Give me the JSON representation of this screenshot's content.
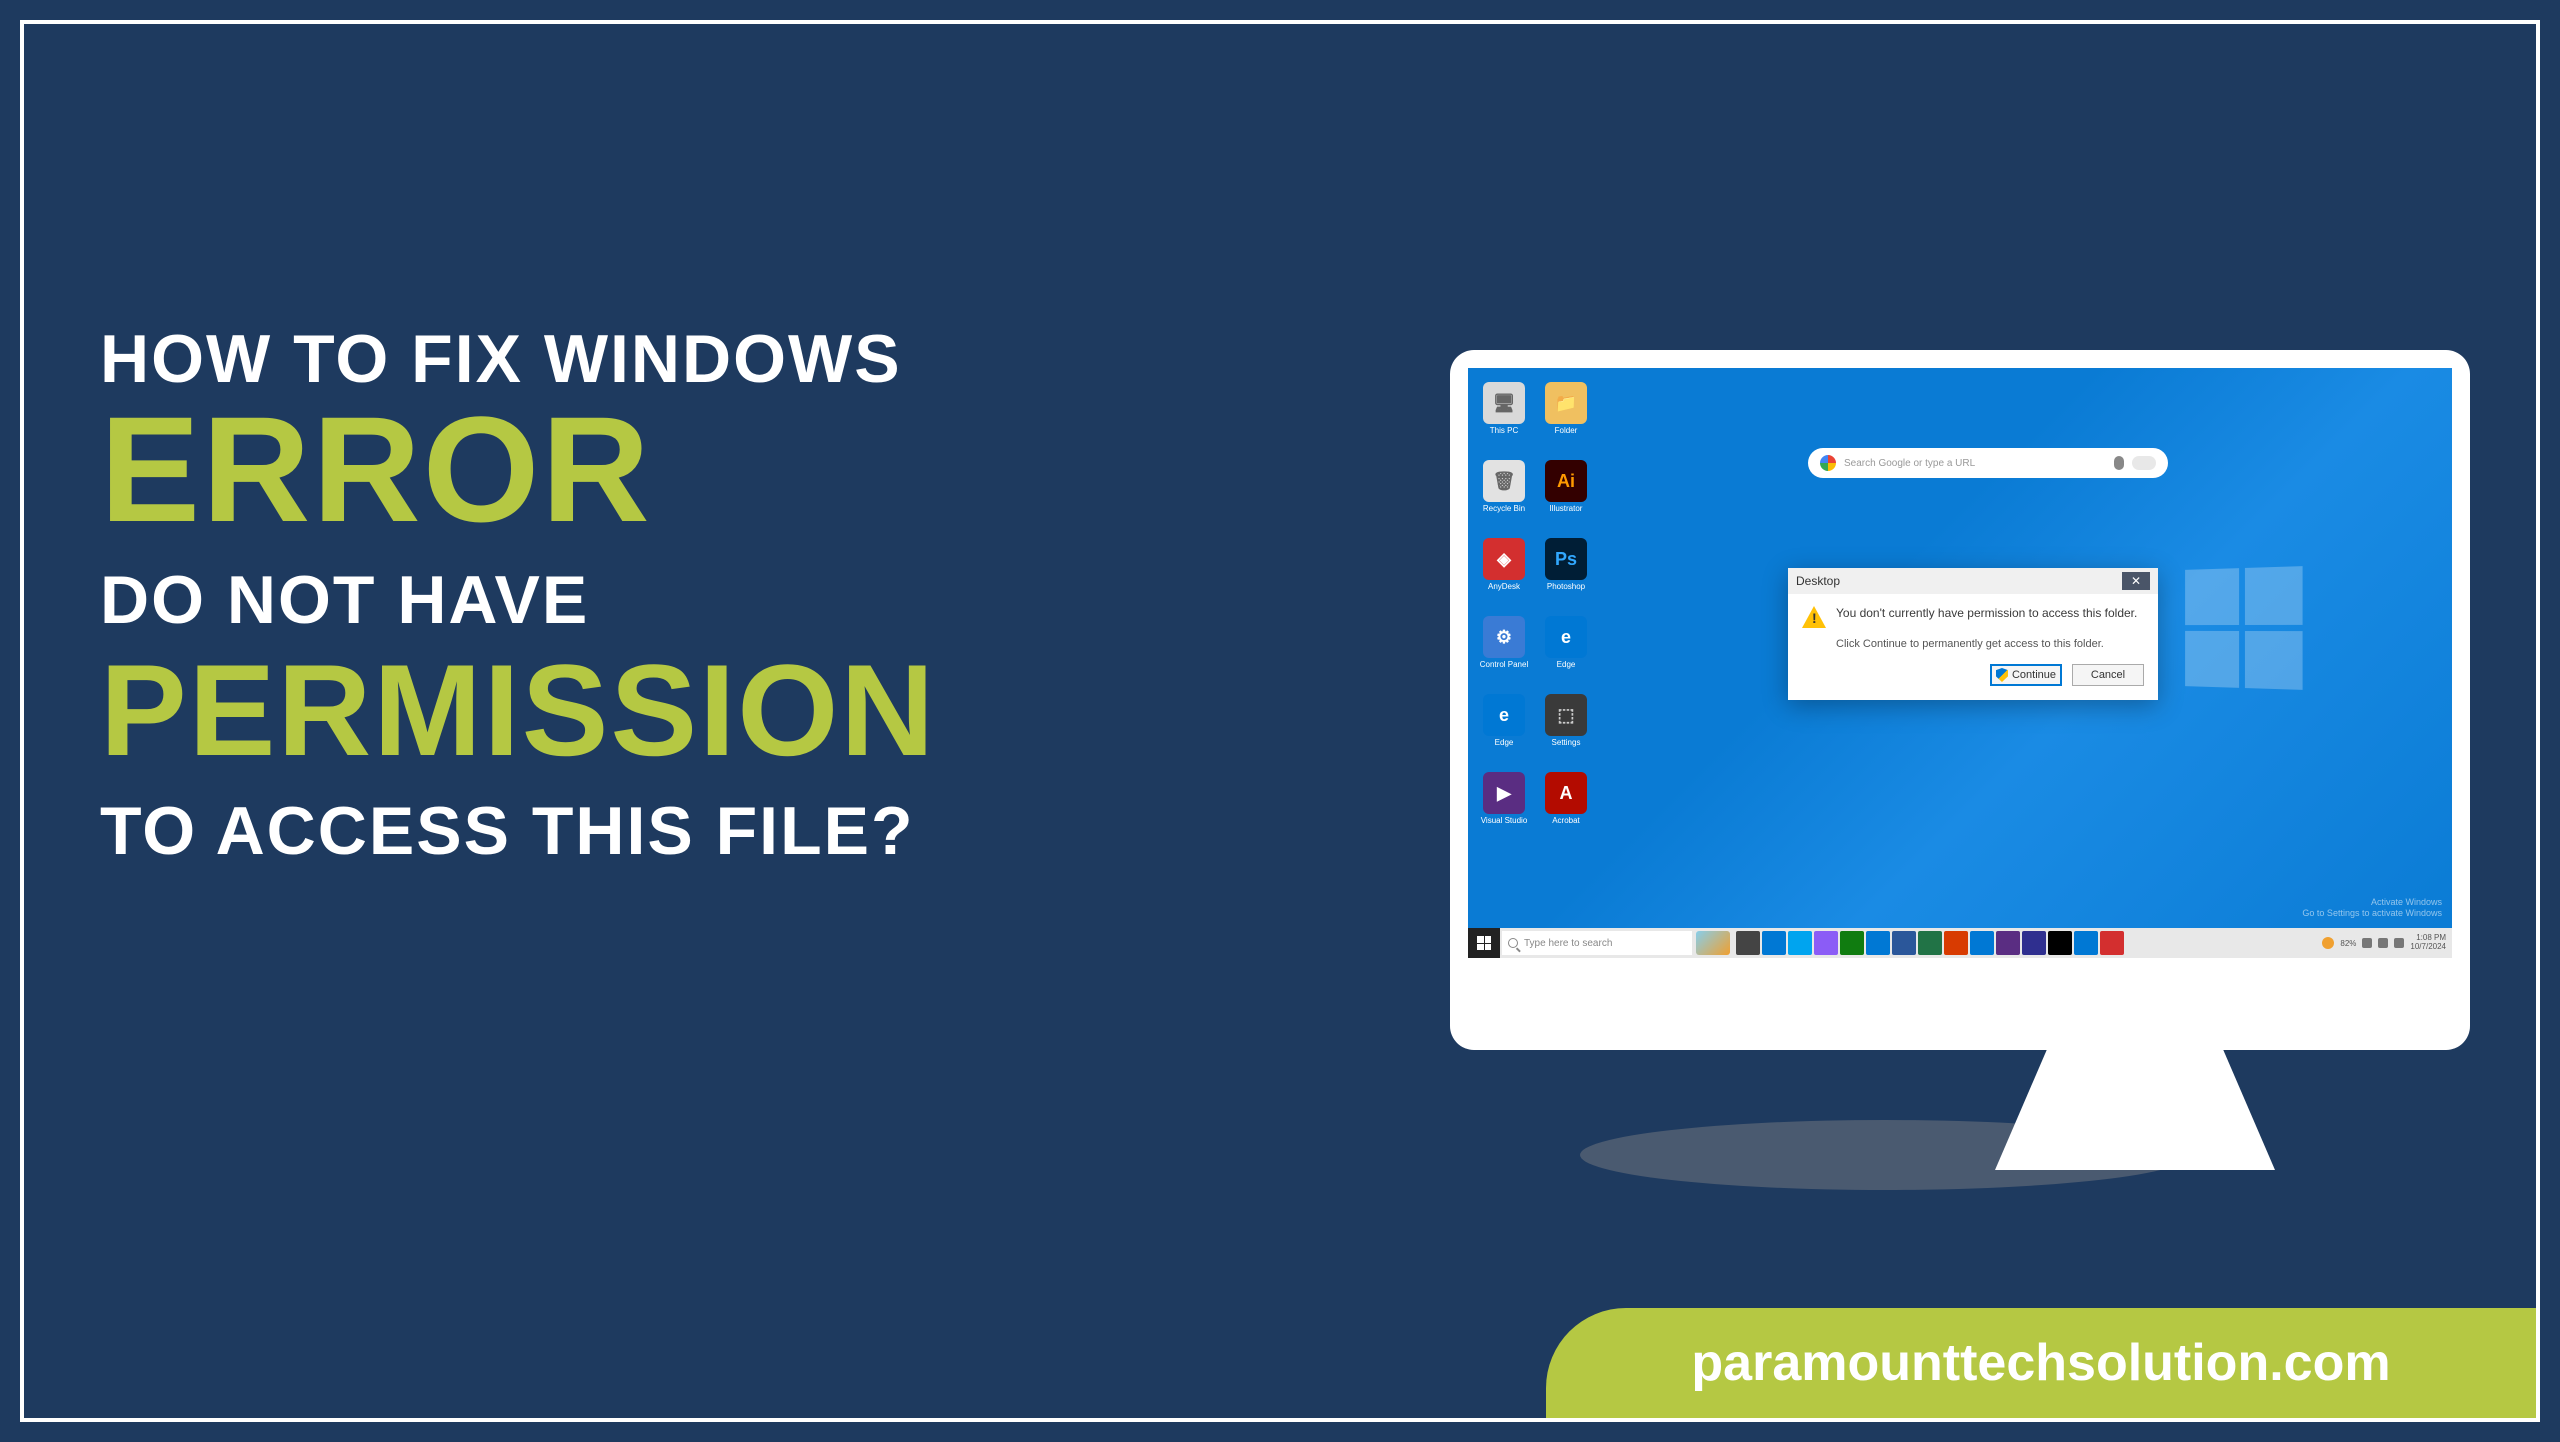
{
  "heading": {
    "line1": "HOW TO FIX WINDOWS",
    "line2": "ERROR",
    "line3": "DO NOT HAVE",
    "line4": "PERMISSION",
    "line5": "TO ACCESS THIS FILE?"
  },
  "brand": "paramounttechsolution.com",
  "screen": {
    "search_placeholder": "Search Google or type a URL",
    "dialog": {
      "title": "Desktop",
      "close": "✕",
      "message": "You don't currently have permission to access this folder.",
      "sub": "Click Continue to permanently get access to this folder.",
      "continue": "Continue",
      "cancel": "Cancel"
    },
    "watermark": {
      "l1": "Activate Windows",
      "l2": "Go to Settings to activate Windows"
    },
    "taskbar": {
      "search": "Type here to search",
      "battery": "82%",
      "time": "1:08 PM",
      "date": "10/7/2024"
    },
    "icons": {
      "col1": [
        {
          "bg": "#d9d9d9",
          "fg": "#666",
          "lbl": "This PC",
          "txt": "🖥"
        },
        {
          "bg": "#e2e2e2",
          "fg": "#666",
          "lbl": "Recycle Bin",
          "txt": "🗑"
        },
        {
          "bg": "#d32f2f",
          "fg": "#fff",
          "lbl": "AnyDesk",
          "txt": "◈"
        },
        {
          "bg": "#3a7bd5",
          "fg": "#fff",
          "lbl": "Control Panel",
          "txt": "⚙"
        },
        {
          "bg": "#0078d4",
          "fg": "#fff",
          "lbl": "Edge",
          "txt": "e"
        },
        {
          "bg": "#5a2d82",
          "fg": "#fff",
          "lbl": "Visual Studio",
          "txt": "▶"
        }
      ],
      "col2": [
        {
          "bg": "#f0c060",
          "fg": "#885",
          "lbl": "Folder",
          "txt": "📁"
        },
        {
          "bg": "#330000",
          "fg": "#ff9a00",
          "lbl": "Illustrator",
          "txt": "Ai"
        },
        {
          "bg": "#001e36",
          "fg": "#31a8ff",
          "lbl": "Photoshop",
          "txt": "Ps"
        },
        {
          "bg": "#0078d4",
          "fg": "#fff",
          "lbl": "Edge",
          "txt": "e"
        },
        {
          "bg": "#3a3a3a",
          "fg": "#ccc",
          "lbl": "Settings",
          "txt": "⬚"
        },
        {
          "bg": "#b30b00",
          "fg": "#fff",
          "lbl": "Acrobat",
          "txt": "A"
        }
      ]
    },
    "taskbar_apps": [
      "#444",
      "#0078d4",
      "#00a4ef",
      "#8b5cf6",
      "#107c10",
      "#0078d4",
      "#2b579a",
      "#217346",
      "#d83b01",
      "#0078d4",
      "#5a2d82",
      "#2f2f8f",
      "#000",
      "#0078d4",
      "#d32f2f"
    ]
  }
}
